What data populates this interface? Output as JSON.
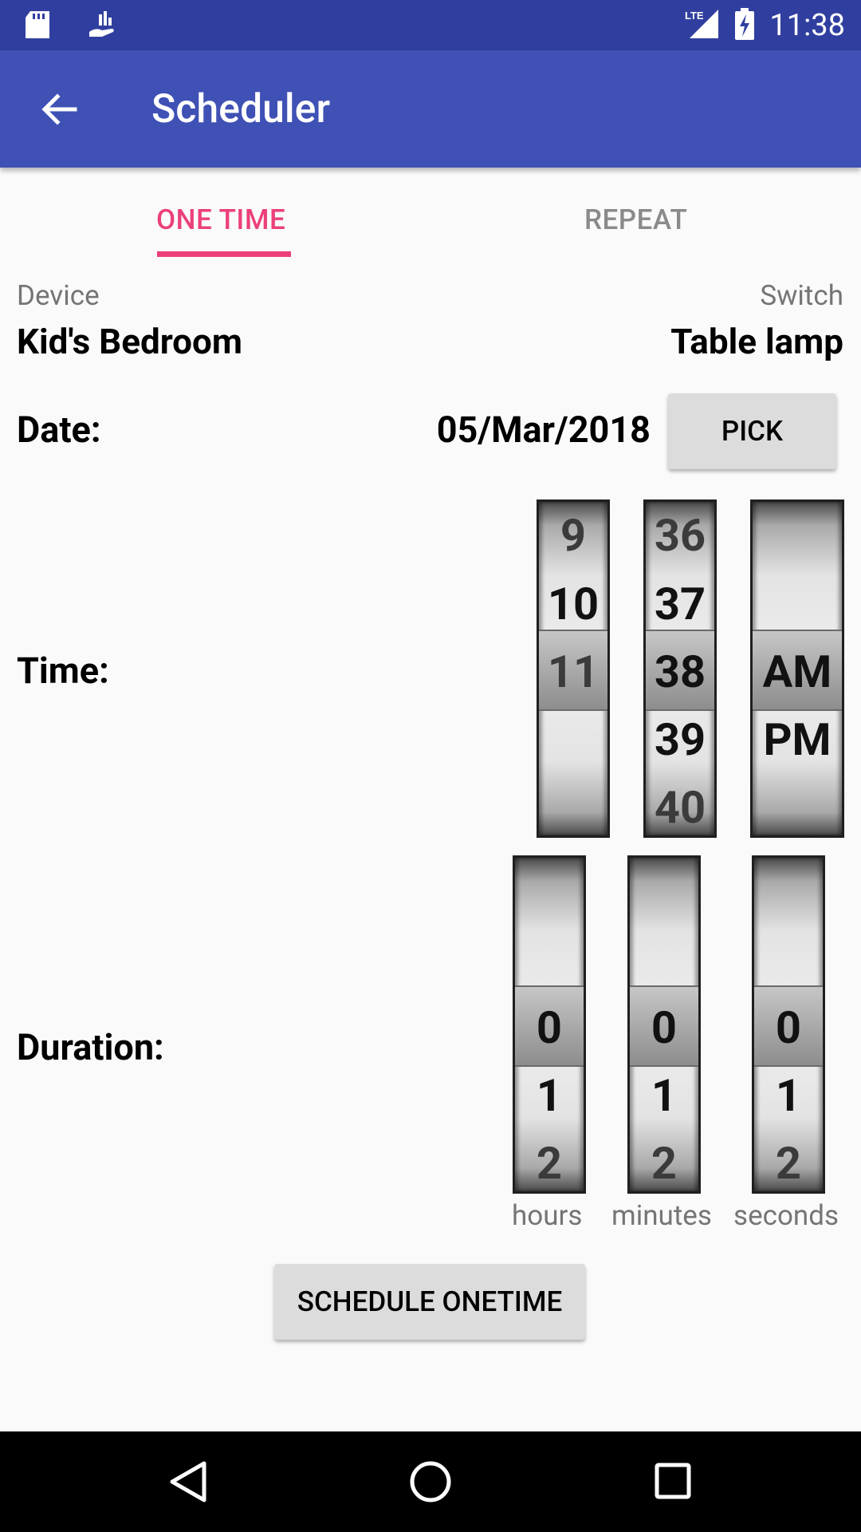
{
  "status_bar": {
    "time": "11:38",
    "icons": [
      "sd-card-icon",
      "hand-money-icon",
      "lte-signal-icon",
      "battery-charging-icon"
    ],
    "network": "LTE"
  },
  "toolbar": {
    "title": "Scheduler",
    "back_icon": "arrow-left-icon"
  },
  "tabs": [
    {
      "label": "ONE TIME",
      "selected": true
    },
    {
      "label": "REPEAT",
      "selected": false
    }
  ],
  "device": {
    "label": "Device",
    "value": "Kid's Bedroom"
  },
  "switch": {
    "label": "Switch",
    "value": "Table lamp"
  },
  "date": {
    "label": "Date:",
    "value": "05/Mar/2018",
    "pick_label": "PICK"
  },
  "time": {
    "label": "Time:",
    "hours": [
      "9",
      "10",
      "11"
    ],
    "minutes": [
      "36",
      "37",
      "38",
      "39",
      "40"
    ],
    "ampm": [
      "AM",
      "PM"
    ]
  },
  "duration": {
    "label": "Duration:",
    "hours": [
      "0",
      "1",
      "2"
    ],
    "minutes": [
      "0",
      "1",
      "2"
    ],
    "seconds": [
      "0",
      "1",
      "2"
    ],
    "unit_hours": "hours",
    "unit_minutes": "minutes",
    "unit_seconds": "seconds"
  },
  "schedule_button": "SCHEDULE ONETIME",
  "colors": {
    "primary": "#3f51b5",
    "primary_dark": "#303f9f",
    "accent": "#ec407a"
  },
  "nav_icons": [
    "back-triangle-icon",
    "home-circle-icon",
    "recents-square-icon"
  ]
}
